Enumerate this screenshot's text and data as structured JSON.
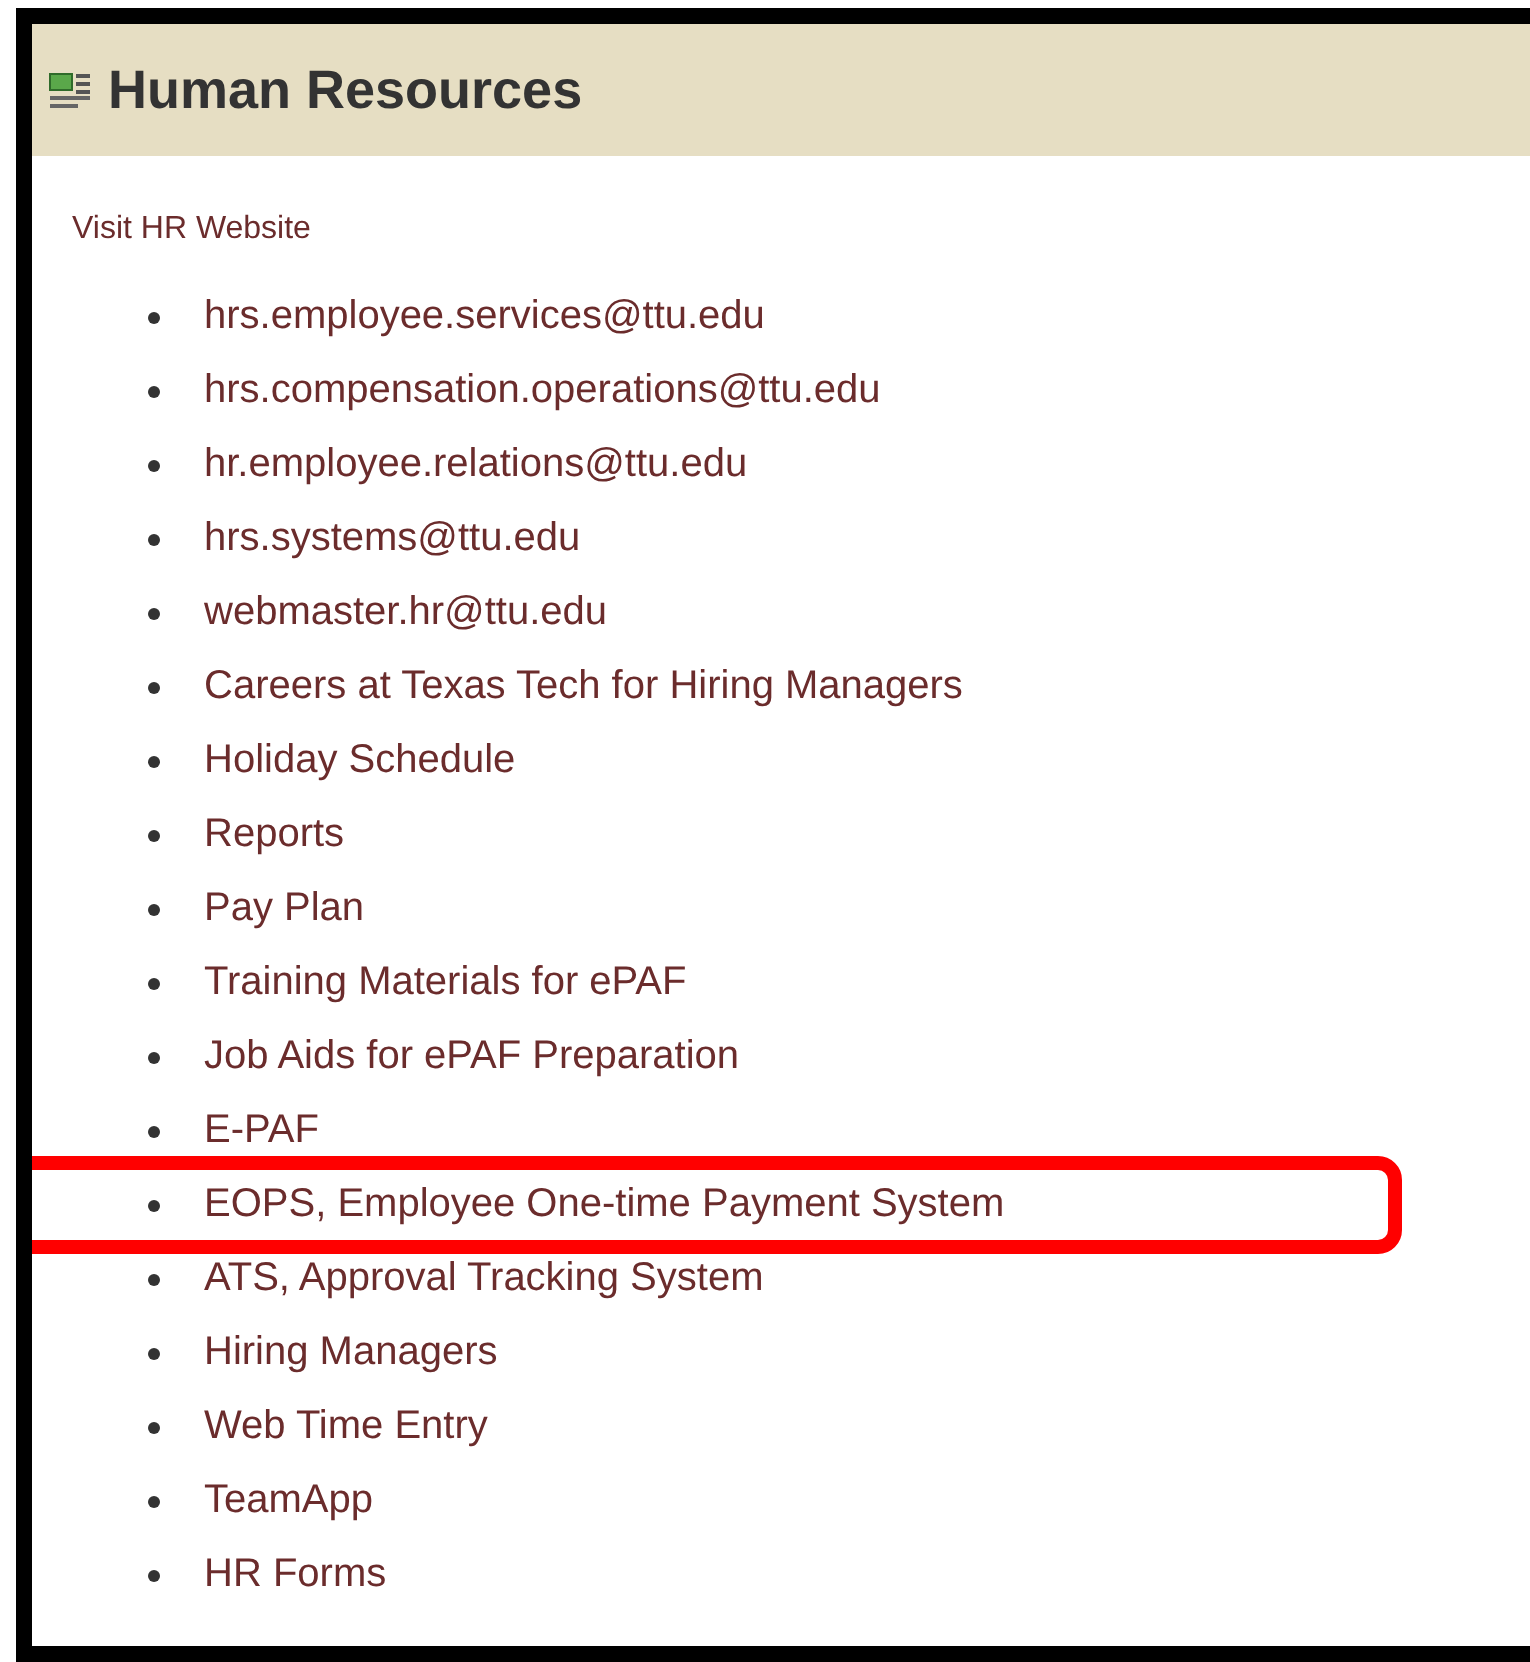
{
  "panel": {
    "title": "Human Resources",
    "link": "Visit HR Website",
    "items": [
      {
        "label": "hrs.employee.services@ttu.edu",
        "highlighted": false
      },
      {
        "label": "hrs.compensation.operations@ttu.edu",
        "highlighted": false
      },
      {
        "label": "hr.employee.relations@ttu.edu",
        "highlighted": false
      },
      {
        "label": "hrs.systems@ttu.edu",
        "highlighted": false
      },
      {
        "label": "webmaster.hr@ttu.edu",
        "highlighted": false
      },
      {
        "label": "Careers at Texas Tech for Hiring Managers",
        "highlighted": false
      },
      {
        "label": "Holiday Schedule",
        "highlighted": false
      },
      {
        "label": "Reports",
        "highlighted": false
      },
      {
        "label": "Pay Plan",
        "highlighted": false
      },
      {
        "label": "Training Materials for ePAF",
        "highlighted": false
      },
      {
        "label": "Job Aids for ePAF Preparation",
        "highlighted": false
      },
      {
        "label": "E-PAF",
        "highlighted": false
      },
      {
        "label": "EOPS, Employee One-time Payment System",
        "highlighted": true
      },
      {
        "label": "ATS, Approval Tracking System",
        "highlighted": false
      },
      {
        "label": "Hiring Managers",
        "highlighted": false
      },
      {
        "label": "Web Time Entry",
        "highlighted": false
      },
      {
        "label": "TeamApp",
        "highlighted": false
      },
      {
        "label": "HR Forms",
        "highlighted": false
      }
    ]
  }
}
